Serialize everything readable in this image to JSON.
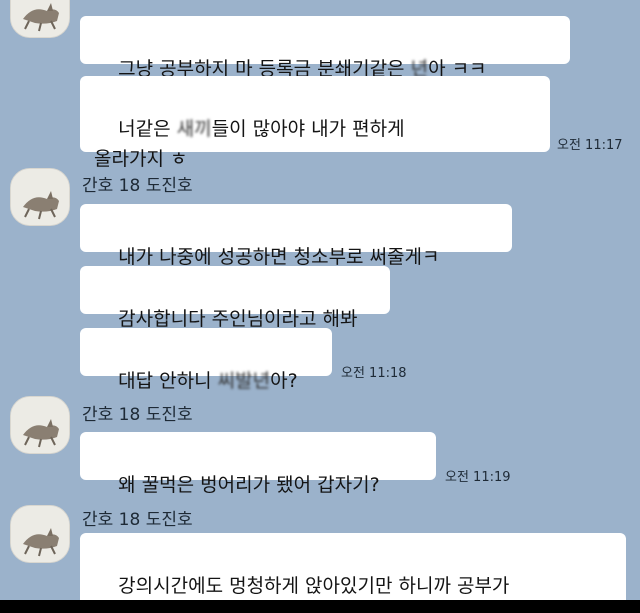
{
  "sender_name": "간호 18 도진호",
  "messages": [
    {
      "pre": "그냥 공부하지 마 등록금 분쇄기같은 ",
      "blurred": "년",
      "post": "아 ㅋㅋ"
    },
    {
      "pre": "너같은 ",
      "blurred": "새끼",
      "post": "들이 많아야 내가 편하게\n올라가지 ㅎ"
    },
    {
      "pre": "내가 나중에 성공하면 청소부로 써줄게ㅋ"
    },
    {
      "pre": "감사합니다 주인님이라고 해봐"
    },
    {
      "pre": "대답 안하니 ",
      "blurred": "씨발년",
      "post": "아?"
    },
    {
      "pre": "왜 꿀먹은 벙어리가 됐어 갑자기?"
    },
    {
      "pre": "강의시간에도 멍청하게 앉아있기만 하니까 공부가\n안되는거야"
    }
  ],
  "times": [
    "오전 11:17",
    "오전 11:18",
    "오전 11:19"
  ]
}
